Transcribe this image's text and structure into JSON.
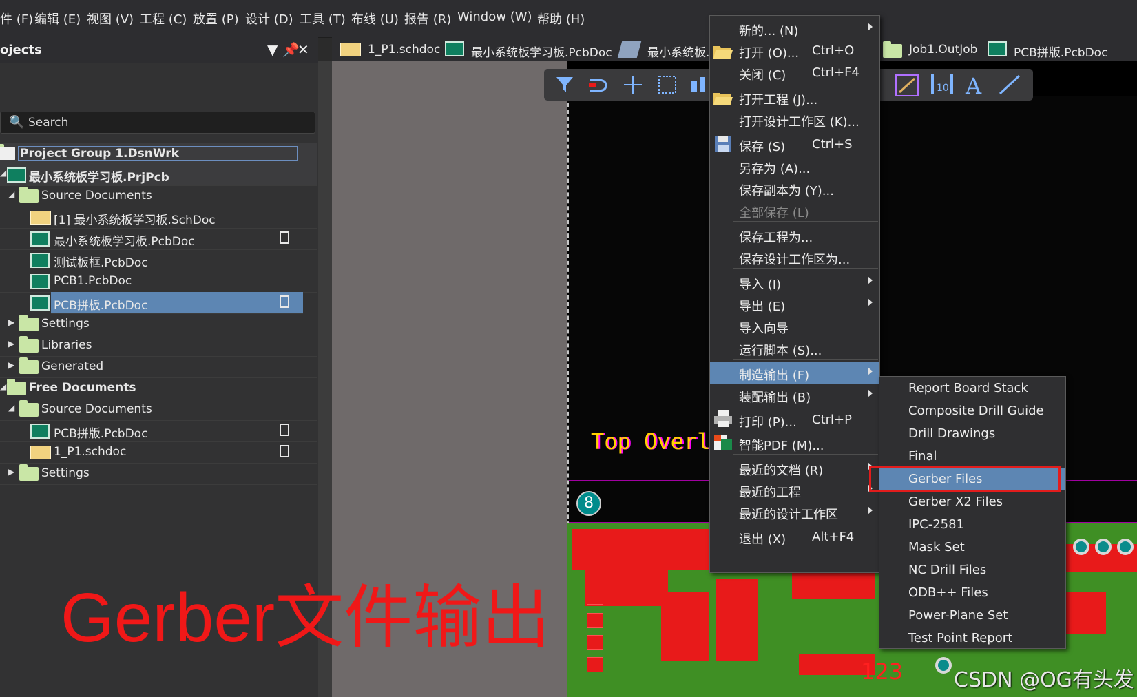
{
  "menubar": {
    "items": [
      "件 (F)",
      "编辑 (E)",
      "视图 (V)",
      "工程 (C)",
      "放置 (P)",
      "设计 (D)",
      "工具 (T)",
      "布线 (U)",
      "报告 (R)",
      "Window (W)",
      "帮助 (H)"
    ]
  },
  "projects_panel": {
    "title": "ojects",
    "search_placeholder": "Search",
    "tree": [
      {
        "label": "Project Group 1.DsnWrk",
        "type": "group"
      },
      {
        "label": "最小系统板学习板.PrjPcb",
        "type": "project"
      },
      {
        "label": "Source Documents",
        "type": "folder"
      },
      {
        "label": "[1] 最小系统板学习板.SchDoc",
        "type": "sch"
      },
      {
        "label": "最小系统板学习板.PcbDoc",
        "type": "pcb"
      },
      {
        "label": "测试板框.PcbDoc",
        "type": "pcb"
      },
      {
        "label": "PCB1.PcbDoc",
        "type": "pcb"
      },
      {
        "label": "PCB拼板.PcbDoc",
        "type": "pcb"
      },
      {
        "label": "Settings",
        "type": "folder"
      },
      {
        "label": "Libraries",
        "type": "folder"
      },
      {
        "label": "Generated",
        "type": "folder"
      },
      {
        "label": "Free Documents",
        "type": "group"
      },
      {
        "label": "Source Documents",
        "type": "folder"
      },
      {
        "label": "PCB拼版.PcbDoc",
        "type": "pcb"
      },
      {
        "label": "1_P1.schdoc",
        "type": "sch"
      },
      {
        "label": "Settings",
        "type": "folder"
      }
    ]
  },
  "tabs": [
    "1_P1.schdoc",
    "最小系统板学习板.PcbDoc",
    "最小系统板.",
    "Job1.OutJob",
    "PCB拼版.PcbDoc"
  ],
  "file_menu": {
    "items": [
      {
        "label": "新的... (N)",
        "shortcut": "",
        "submenu": true
      },
      {
        "label": "打开 (O)...",
        "shortcut": "Ctrl+O"
      },
      {
        "label": "关闭 (C)",
        "shortcut": "Ctrl+F4"
      },
      {
        "label": "打开工程 (J)...",
        "shortcut": ""
      },
      {
        "label": "打开设计工作区 (K)...",
        "shortcut": ""
      },
      {
        "label": "保存 (S)",
        "shortcut": "Ctrl+S"
      },
      {
        "label": "另存为 (A)...",
        "shortcut": ""
      },
      {
        "label": "保存副本为 (Y)...",
        "shortcut": ""
      },
      {
        "label": "全部保存 (L)",
        "shortcut": "",
        "disabled": true
      },
      {
        "label": "保存工程为...",
        "shortcut": ""
      },
      {
        "label": "保存设计工作区为...",
        "shortcut": ""
      },
      {
        "label": "导入 (I)",
        "shortcut": "",
        "submenu": true
      },
      {
        "label": "导出 (E)",
        "shortcut": "",
        "submenu": true
      },
      {
        "label": "导入向导",
        "shortcut": ""
      },
      {
        "label": "运行脚本 (S)...",
        "shortcut": ""
      },
      {
        "label": "制造输出 (F)",
        "shortcut": "",
        "submenu": true,
        "active": true
      },
      {
        "label": "装配输出 (B)",
        "shortcut": "",
        "submenu": true
      },
      {
        "label": "打印 (P)...",
        "shortcut": "Ctrl+P"
      },
      {
        "label": "智能PDF (M)...",
        "shortcut": ""
      },
      {
        "label": "最近的文档 (R)",
        "shortcut": "",
        "submenu": true
      },
      {
        "label": "最近的工程",
        "shortcut": "",
        "submenu": true
      },
      {
        "label": "最近的设计工作区",
        "shortcut": "",
        "submenu": true
      },
      {
        "label": "退出 (X)",
        "shortcut": "Alt+F4"
      }
    ]
  },
  "fab_submenu": {
    "items": [
      "Report Board Stack",
      "Composite Drill Guide",
      "Drill Drawings",
      "Final",
      "Gerber Files",
      "Gerber X2 Files",
      "IPC-2581",
      "Mask Set",
      "NC Drill Files",
      "ODB++ Files",
      "Power-Plane Set",
      "Test Point Report"
    ],
    "highlighted": "Gerber Files"
  },
  "canvas": {
    "overlay_text": "Top Overla",
    "layer_badge": "8",
    "silk_text": "123"
  },
  "caption": "Gerber文件输出",
  "watermark": "CSDN @OG有头发",
  "colors": {
    "accent_blue": "#5d86b3",
    "highlight_red": "#e21c1c",
    "pcb_green": "#3f8f24",
    "copper_red": "#e81a1a"
  }
}
